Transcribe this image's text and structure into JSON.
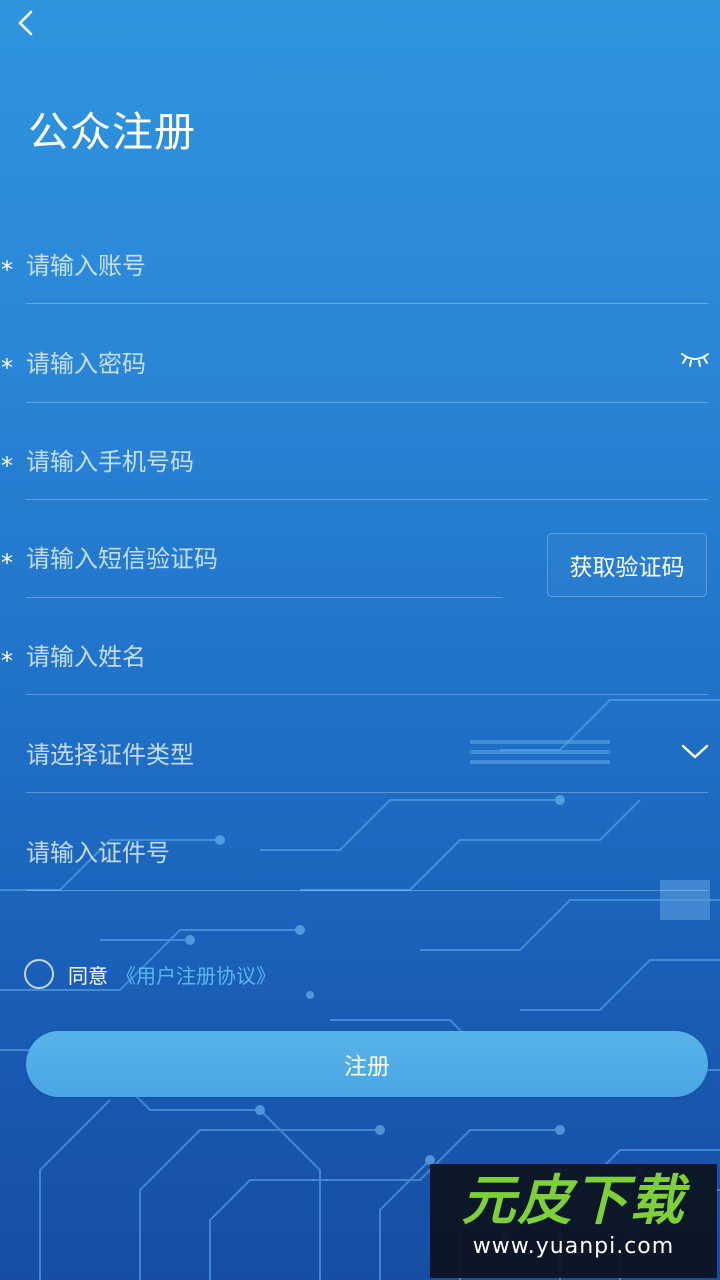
{
  "header": {
    "back_icon": "chevron-left-icon",
    "title": "公众注册"
  },
  "form": {
    "account": {
      "required_mark": "*",
      "placeholder": "请输入账号",
      "value": ""
    },
    "password": {
      "required_mark": "*",
      "placeholder": "请输入密码",
      "value": "",
      "toggle_icon": "eye-closed-icon"
    },
    "phone": {
      "required_mark": "*",
      "placeholder": "请输入手机号码",
      "value": ""
    },
    "sms_code": {
      "required_mark": "*",
      "placeholder": "请输入短信验证码",
      "value": "",
      "button_label": "获取验证码"
    },
    "name": {
      "required_mark": "*",
      "placeholder": "请输入姓名",
      "value": ""
    },
    "id_type": {
      "placeholder": "请选择证件类型",
      "selected": "",
      "dropdown_icon": "chevron-down-icon"
    },
    "id_number": {
      "placeholder": "请输入证件号",
      "value": ""
    }
  },
  "agreement": {
    "checked": false,
    "prefix": "同意",
    "link_text": "《用户注册协议》"
  },
  "submit": {
    "label": "注册"
  },
  "watermark": {
    "logo_text": "元皮下载",
    "url": "www.yuanpi.com"
  },
  "colors": {
    "background_top": "#2f95df",
    "background_bottom": "#164ea5",
    "button": "#4ea9e5",
    "link": "#57b9ef",
    "watermark_green": "#7ed03b"
  }
}
